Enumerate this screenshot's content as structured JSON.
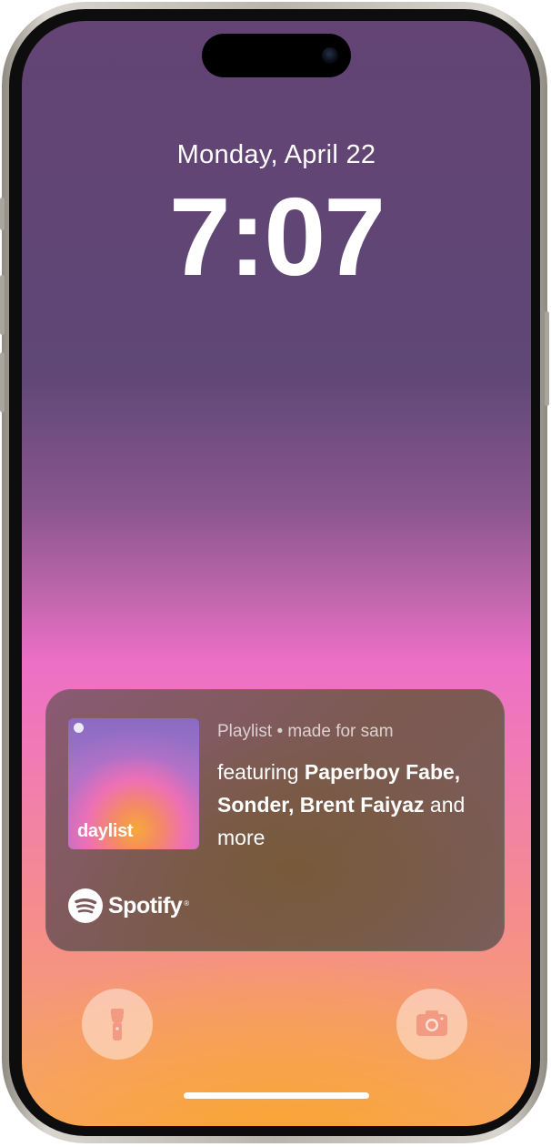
{
  "lockscreen": {
    "date": "Monday, April 22",
    "time": "7:07"
  },
  "widget": {
    "cover_title": "daylist",
    "meta": "Playlist • made for sam",
    "description_prefix": "featuring ",
    "featured_artists": [
      "Paperboy Fabe",
      "Sonder",
      "Brent Faiyaz"
    ],
    "artist_separator": ", ",
    "description_suffix": " and more",
    "brand": "Spotify",
    "brand_mark": "®"
  },
  "quick_actions": {
    "left_icon": "flashlight-icon",
    "right_icon": "camera-icon"
  },
  "colors": {
    "top_background": "#634474",
    "mid_background": "#ed6fc6",
    "bottom_background": "#f8a56a",
    "widget_text": "#ffffff"
  }
}
